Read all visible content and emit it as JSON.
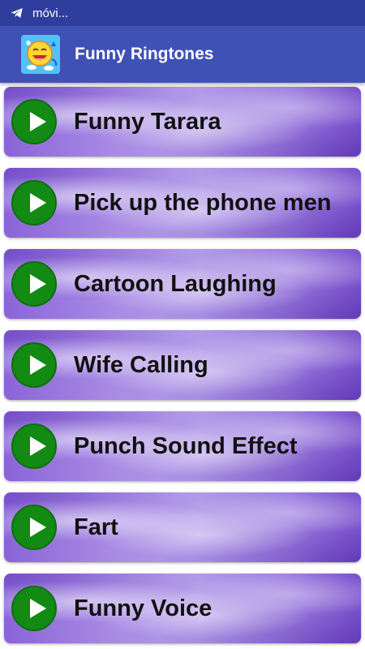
{
  "status_bar": {
    "notification_icon": "telegram-icon",
    "text": "móvi..."
  },
  "app_bar": {
    "icon": "laughing-face-icon",
    "title": "Funny Ringtones"
  },
  "ringtones": [
    {
      "label": "Funny Tarara",
      "icon": "play-icon"
    },
    {
      "label": "Pick up the phone men",
      "icon": "play-icon"
    },
    {
      "label": "Cartoon Laughing",
      "icon": "play-icon"
    },
    {
      "label": "Wife Calling",
      "icon": "play-icon"
    },
    {
      "label": "Punch Sound Effect",
      "icon": "play-icon"
    },
    {
      "label": "Fart",
      "icon": "play-icon"
    },
    {
      "label": "Funny Voice",
      "icon": "play-icon"
    }
  ],
  "colors": {
    "status_bar": "#2f3e9e",
    "app_bar": "#3f51b5",
    "play_button": "#138a13",
    "item_background": "#a88ae4"
  }
}
